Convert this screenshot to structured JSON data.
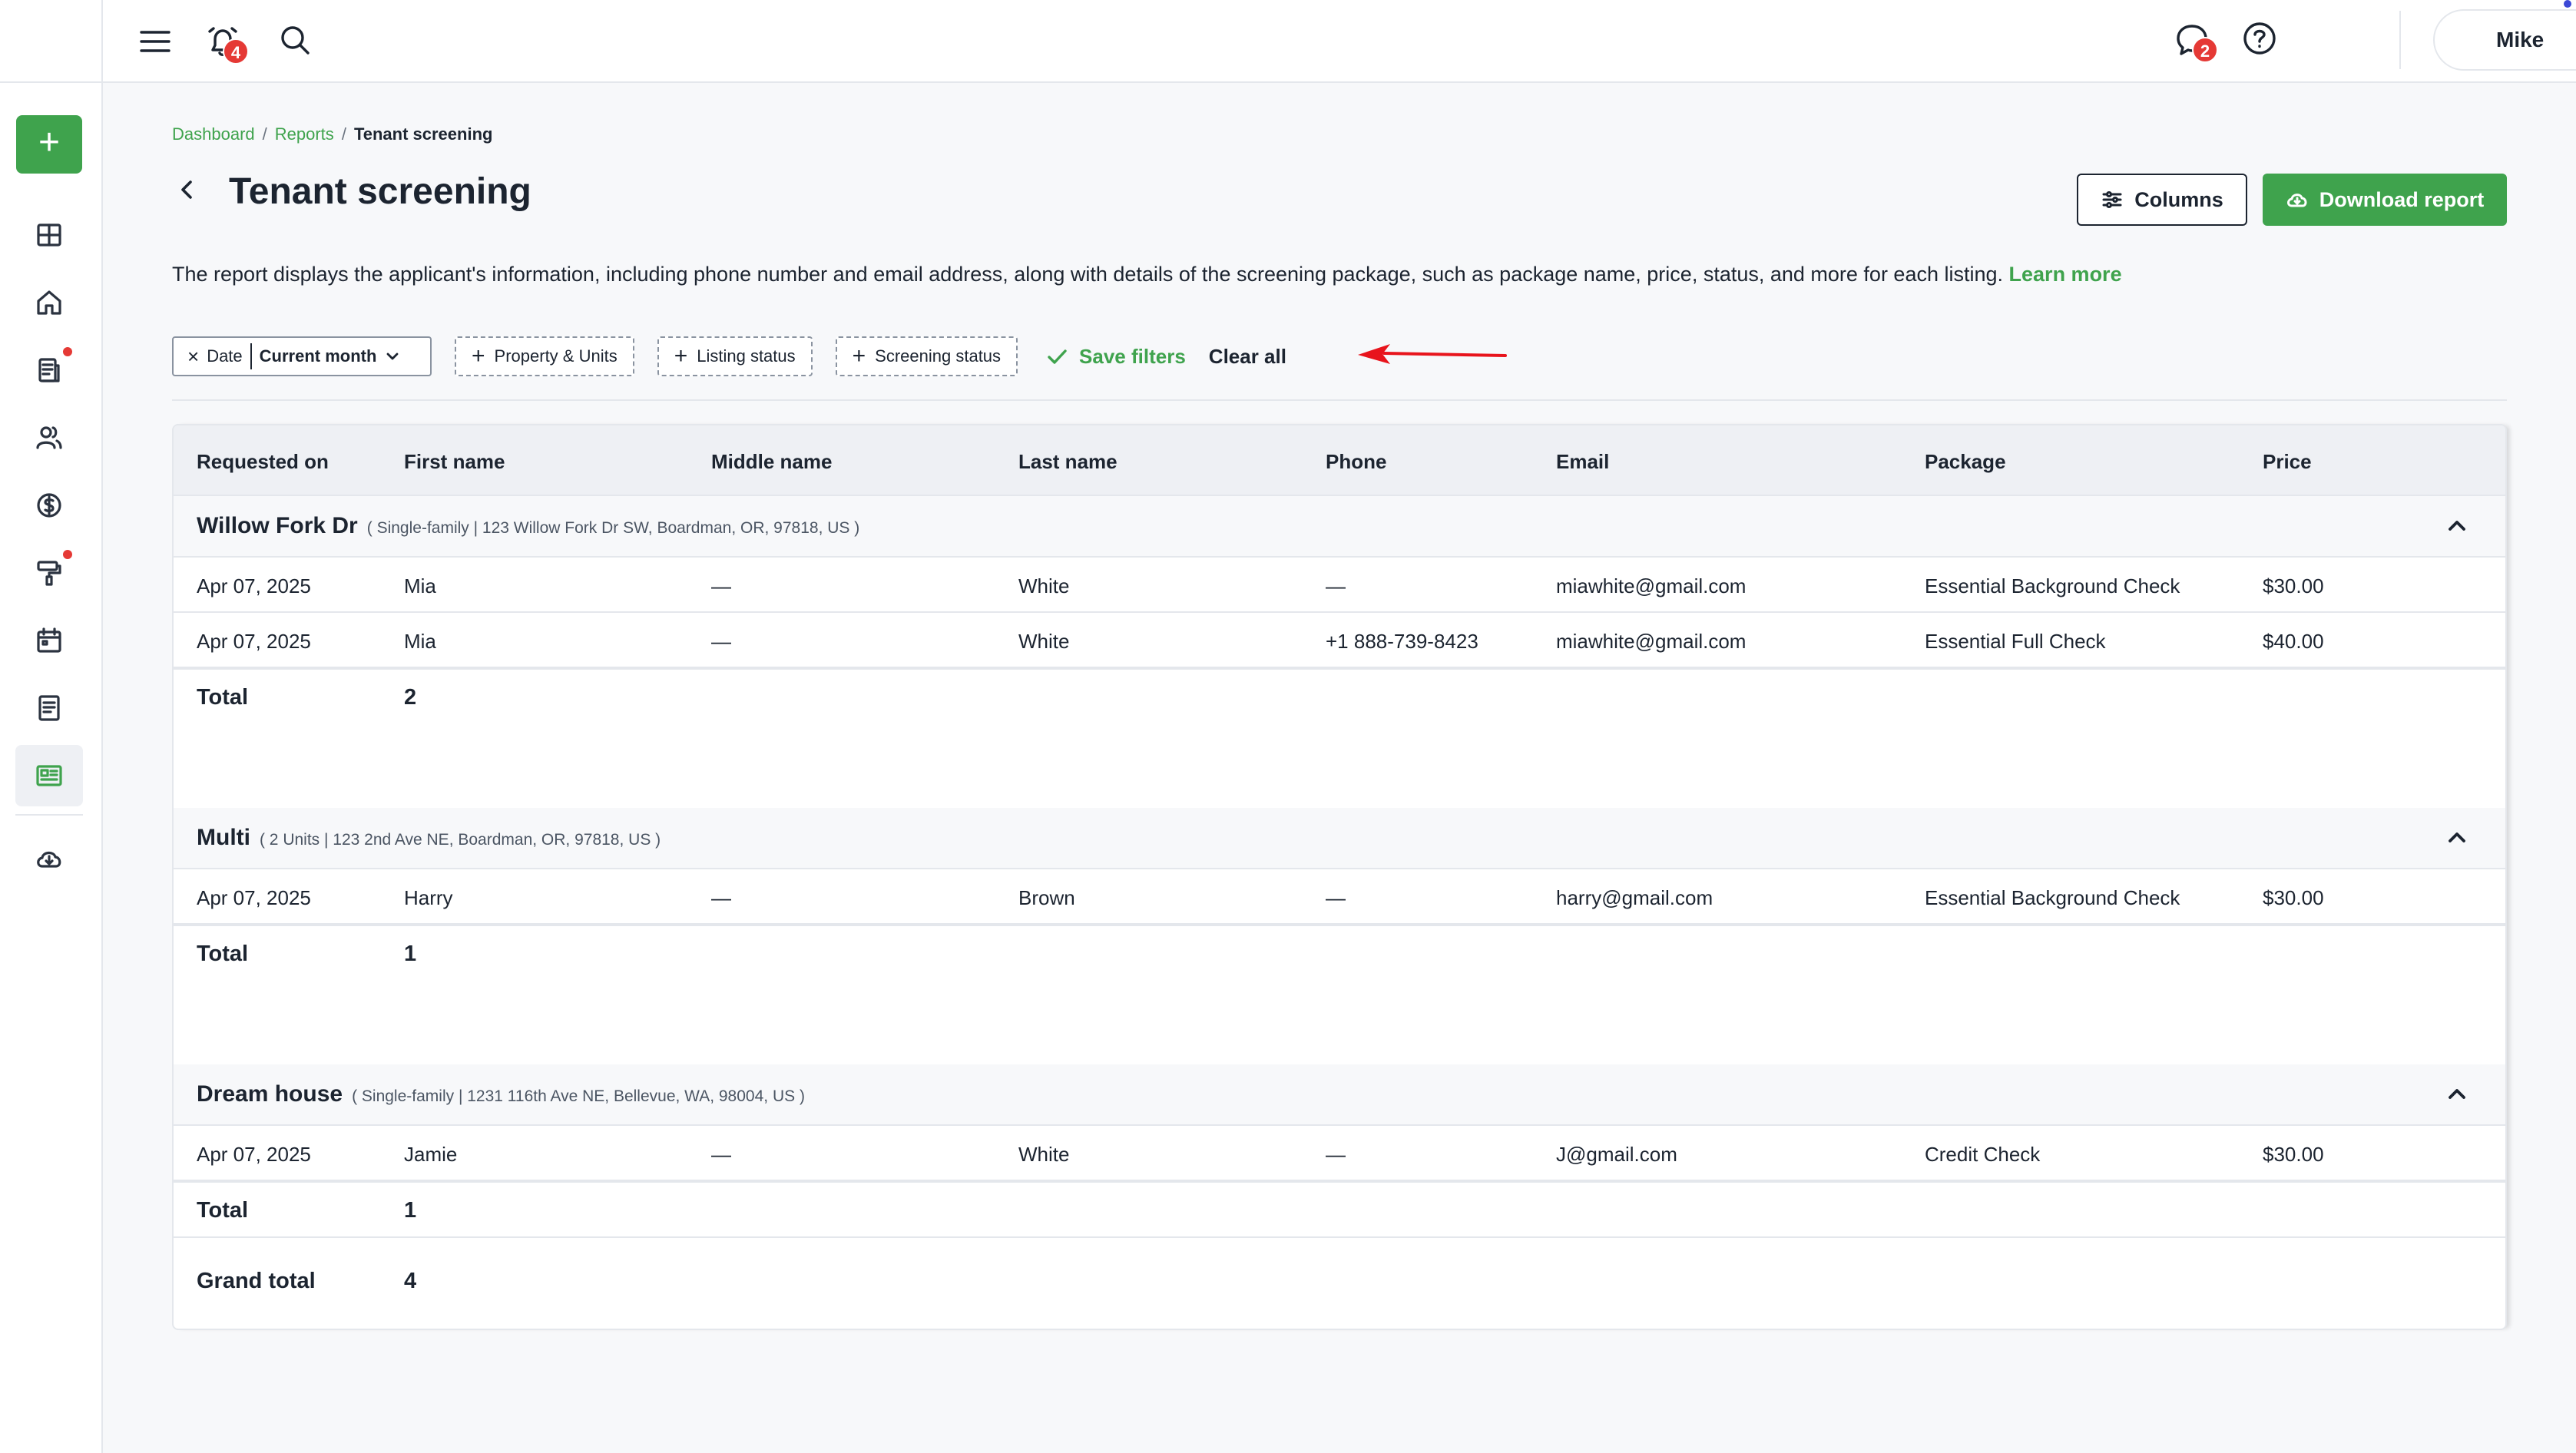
{
  "topbar": {
    "notifications_count": "4",
    "messages_count": "2",
    "user_name": "Mike"
  },
  "sidebar": {
    "add_label": "+",
    "items": [
      {
        "name": "dashboard",
        "icon": "dashboard-grid-icon"
      },
      {
        "name": "properties",
        "icon": "home-icon"
      },
      {
        "name": "leases",
        "icon": "document-icon",
        "dot": true
      },
      {
        "name": "people",
        "icon": "people-icon"
      },
      {
        "name": "accounting",
        "icon": "dollar-icon"
      },
      {
        "name": "maintenance",
        "icon": "paint-roller-icon",
        "dot": true
      },
      {
        "name": "calendar",
        "icon": "calendar-icon"
      },
      {
        "name": "tasks",
        "icon": "notes-icon"
      },
      {
        "name": "reports",
        "icon": "report-icon",
        "active": true
      },
      {
        "name": "downloads",
        "icon": "cloud-download-icon"
      }
    ]
  },
  "breadcrumb": {
    "items": [
      "Dashboard",
      "Reports",
      "Tenant screening"
    ],
    "separator": "/"
  },
  "page": {
    "title": "Tenant screening",
    "description": "The report displays the applicant's information, including phone number and email address, along with details of the screening package, such as package name, price, status, and more for each listing.",
    "learn_more": "Learn more"
  },
  "actions": {
    "columns": "Columns",
    "download": "Download report"
  },
  "filters": {
    "date_label": "Date",
    "date_value": "Current month",
    "add_filters": [
      "Property & Units",
      "Listing status",
      "Screening status"
    ],
    "save": "Save filters",
    "clear": "Clear all"
  },
  "table": {
    "columns": [
      "Requested on",
      "First name",
      "Middle name",
      "Last name",
      "Phone",
      "Email",
      "Package",
      "Price"
    ],
    "groups": [
      {
        "name": "Willow Fork Dr",
        "subtitle": "( Single-family | 123 Willow Fork Dr SW, Boardman, OR, 97818, US )",
        "rows": [
          [
            "Apr 07, 2025",
            "Mia",
            "—",
            "White",
            "—",
            "miawhite@gmail.com",
            "Essential Background Check",
            "$30.00"
          ],
          [
            "Apr 07, 2025",
            "Mia",
            "—",
            "White",
            "+1 888-739-8423",
            "miawhite@gmail.com",
            "Essential Full Check",
            "$40.00"
          ]
        ],
        "total_label": "Total",
        "total": "2"
      },
      {
        "name": "Multi",
        "subtitle": "( 2 Units | 123 2nd Ave NE, Boardman, OR, 97818, US )",
        "rows": [
          [
            "Apr 07, 2025",
            "Harry",
            "—",
            "Brown",
            "—",
            "harry@gmail.com",
            "Essential Background Check",
            "$30.00"
          ]
        ],
        "total_label": "Total",
        "total": "1"
      },
      {
        "name": "Dream house",
        "subtitle": "( Single-family | 1231 116th Ave NE, Bellevue, WA, 98004, US )",
        "rows": [
          [
            "Apr 07, 2025",
            "Jamie",
            "—",
            "White",
            "—",
            "J@gmail.com",
            "Credit Check",
            "$30.00"
          ]
        ],
        "total_label": "Total",
        "total": "1"
      }
    ],
    "grand_total_label": "Grand total",
    "grand_total": "4"
  },
  "colors": {
    "accent": "#3fa34d",
    "badge": "#e53935",
    "annotation_arrow": "#e8141c"
  }
}
